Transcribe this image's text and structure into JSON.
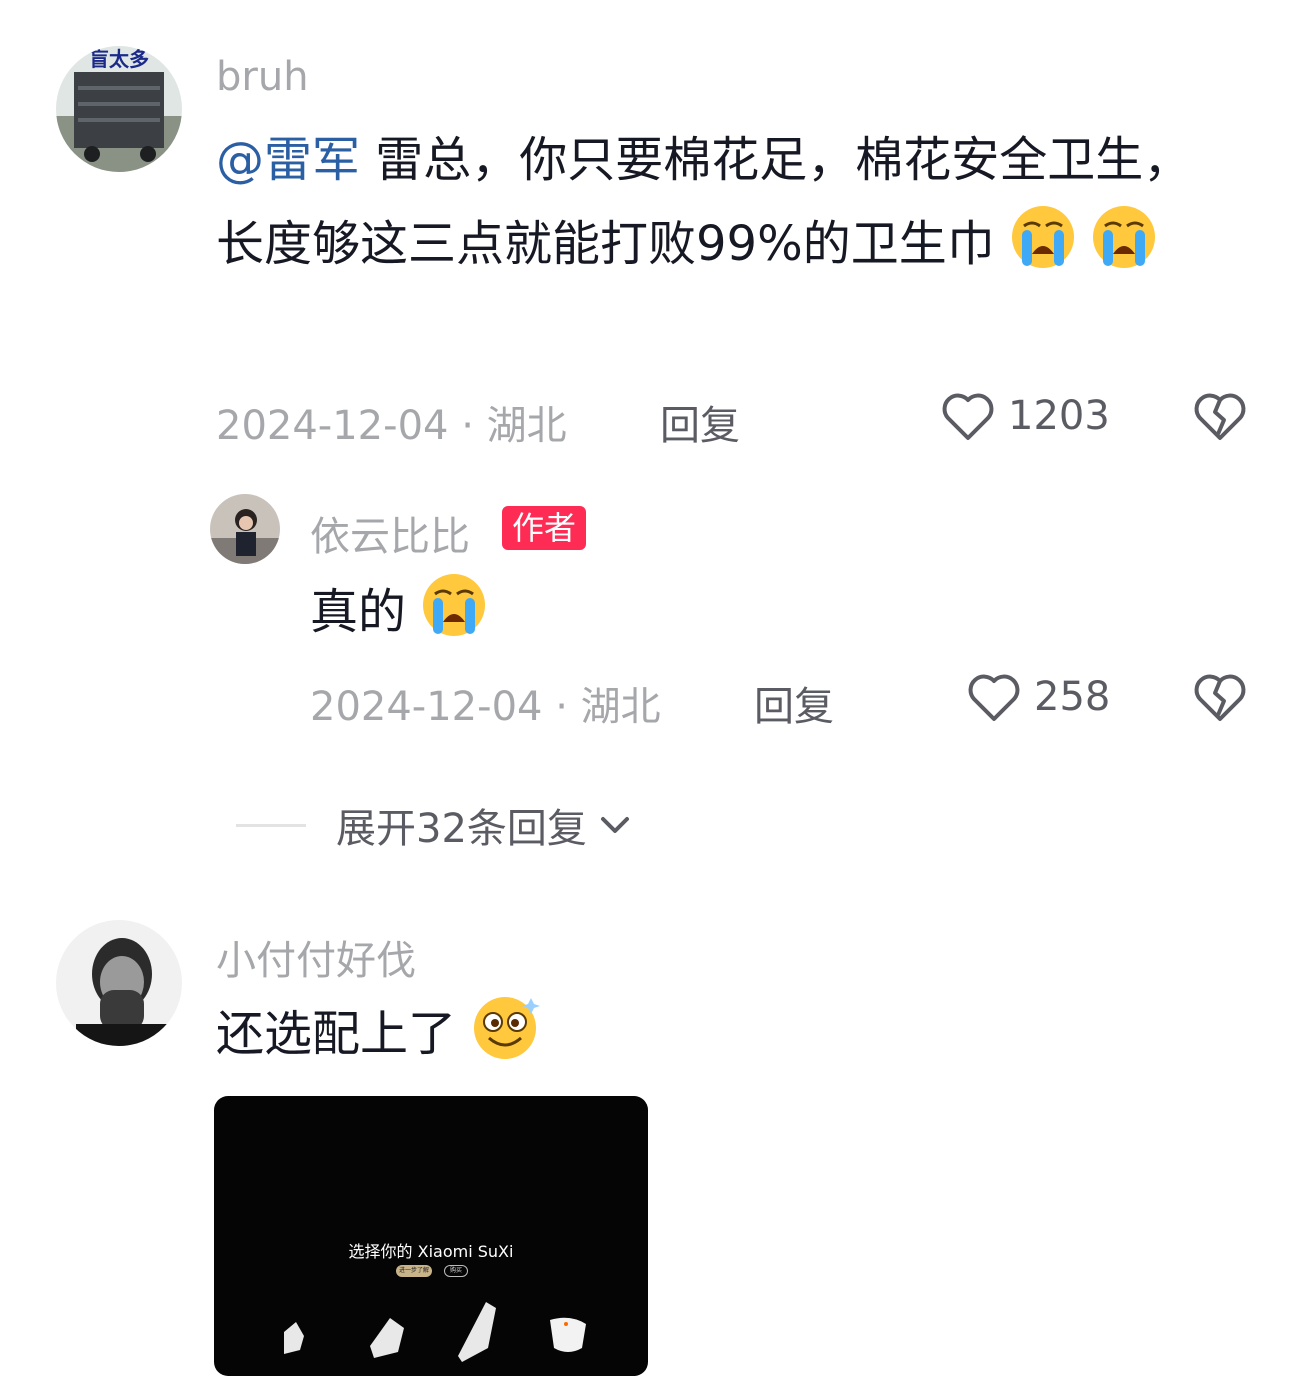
{
  "comments": [
    {
      "username": "bruh",
      "mention": "@雷军",
      "text": " 雷总，你只要棉花足，棉花安全卫生，长度够这三点就能打败99%的卫生巾",
      "date": "2024-12-04",
      "location": "湖北",
      "reply_label": "回复",
      "likes": "1203",
      "avatar_text": "盲太多"
    },
    {
      "username": "依云比比",
      "badge": "作者",
      "text": "真的",
      "date": "2024-12-04",
      "location": "湖北",
      "reply_label": "回复",
      "likes": "258"
    },
    {
      "username": "小付付好伐",
      "text": "还选配上了",
      "media": {
        "title": "选择你的 Xiaomi SuXi",
        "pill_primary": "进一步了解",
        "pill_secondary": "购买"
      }
    }
  ],
  "expand_replies": "展开32条回复",
  "separator": "·",
  "colors": {
    "username": "#a6a7ab",
    "mention": "#2b5fa3",
    "author_badge": "#fe2c55",
    "meta": "#a6a7ab",
    "action": "#5b5c63"
  },
  "icons": [
    "heart-outline-icon",
    "broken-heart-icon",
    "chevron-down-icon",
    "loudly-crying-emoji",
    "dizzy-face-emoji"
  ]
}
